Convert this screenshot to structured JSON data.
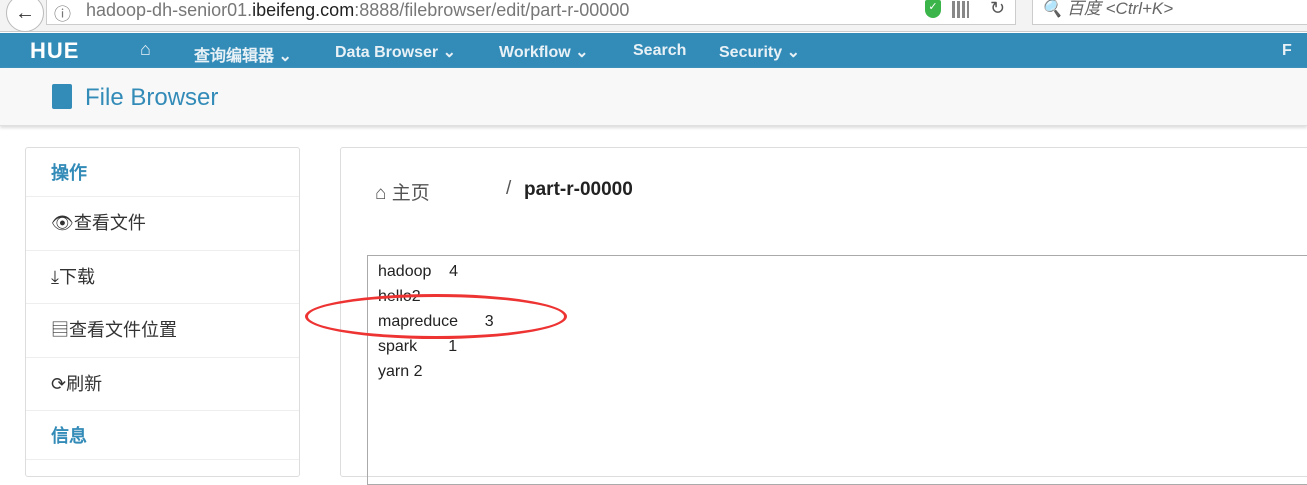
{
  "browser": {
    "url_prefix": "hadoop-dh-senior01.",
    "url_domain": "ibeifeng.com",
    "url_suffix": ":8888/filebrowser/edit/part-r-00000",
    "search_placeholder": "百度 <Ctrl+K>"
  },
  "nav": {
    "logo": "HUE",
    "items": [
      "查询编辑器 ⌄",
      "Data Browser ⌄",
      "Workflow ⌄",
      "Search",
      "Security ⌄"
    ],
    "right": "F"
  },
  "page": {
    "title": "File Browser"
  },
  "sidebar": {
    "section1": "操作",
    "items": [
      "查看文件",
      "下载",
      "查看文件位置",
      "刷新"
    ],
    "section2": "信息"
  },
  "breadcrumb": {
    "home": "主页",
    "sep": "/",
    "file": "part-r-00000"
  },
  "file_content": [
    "hadoop    4",
    "hello2",
    "mapreduce      3",
    "spark       1",
    "yarn 2"
  ]
}
